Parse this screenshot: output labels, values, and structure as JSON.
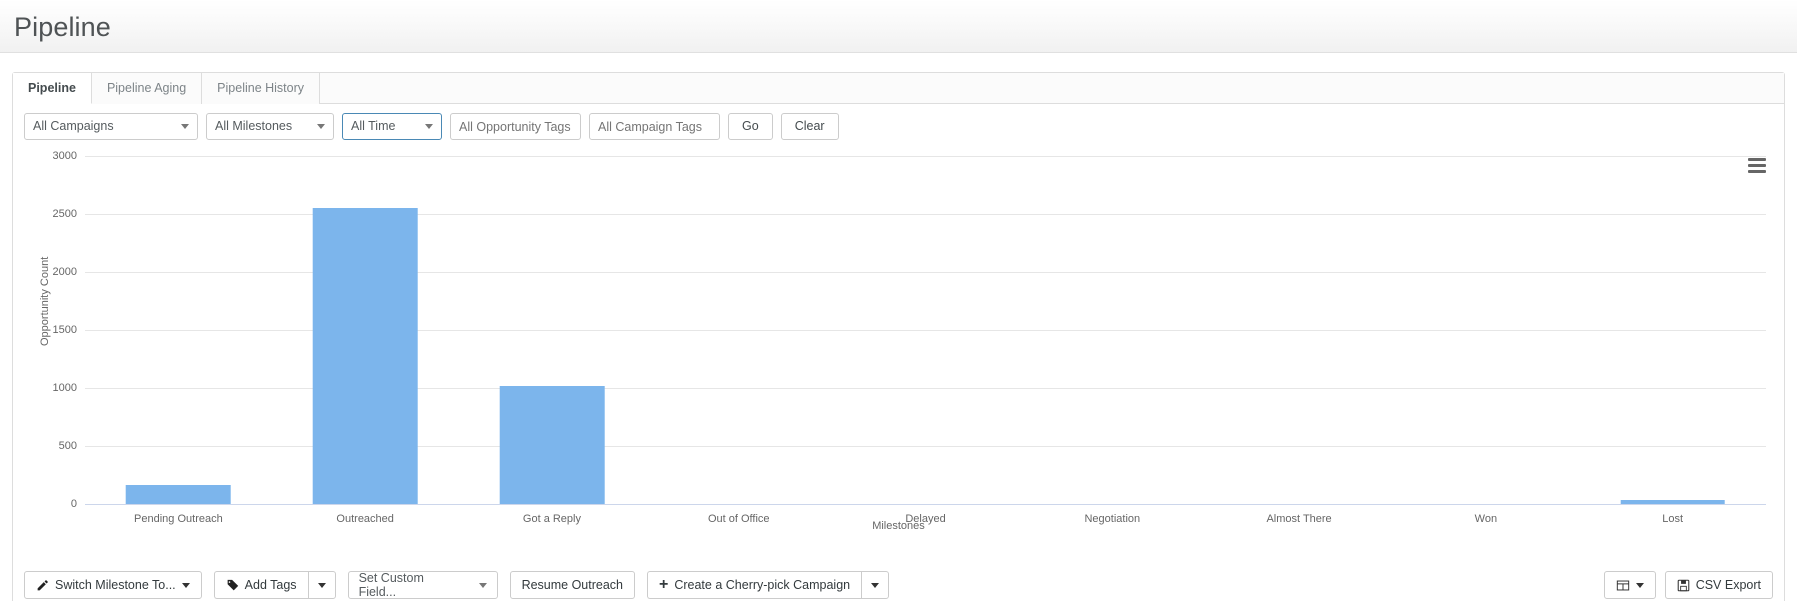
{
  "header": {
    "title": "Pipeline"
  },
  "tabs": [
    {
      "label": "Pipeline",
      "active": true
    },
    {
      "label": "Pipeline Aging",
      "active": false
    },
    {
      "label": "Pipeline History",
      "active": false
    }
  ],
  "filters": {
    "campaigns": "All Campaigns",
    "milestones": "All Milestones",
    "time": "All Time",
    "opportunity_tags_placeholder": "All Opportunity Tags",
    "campaign_tags_placeholder": "All Campaign Tags",
    "go_label": "Go",
    "clear_label": "Clear"
  },
  "chart_menu_icon": "hamburger-icon",
  "chart_data": {
    "type": "bar",
    "title": "",
    "xlabel": "Milestones",
    "ylabel": "Opportunity Count",
    "categories": [
      "Pending Outreach",
      "Outreached",
      "Got a Reply",
      "Out of Office",
      "Delayed",
      "Negotiation",
      "Almost There",
      "Won",
      "Lost"
    ],
    "values": [
      160,
      2550,
      1020,
      0,
      0,
      0,
      0,
      0,
      35
    ],
    "yticks": [
      0,
      500,
      1000,
      1500,
      2000,
      2500,
      3000
    ],
    "ylim": [
      0,
      3000
    ],
    "grid": true,
    "legend": "none",
    "bar_color": "#7cb5ec"
  },
  "toolbar": {
    "switch_milestone": "Switch Milestone To...",
    "add_tags": "Add Tags",
    "set_custom_field": "Set Custom Field...",
    "resume_outreach": "Resume Outreach",
    "create_campaign": "Create a Cherry-pick Campaign",
    "csv_export": "CSV Export"
  }
}
